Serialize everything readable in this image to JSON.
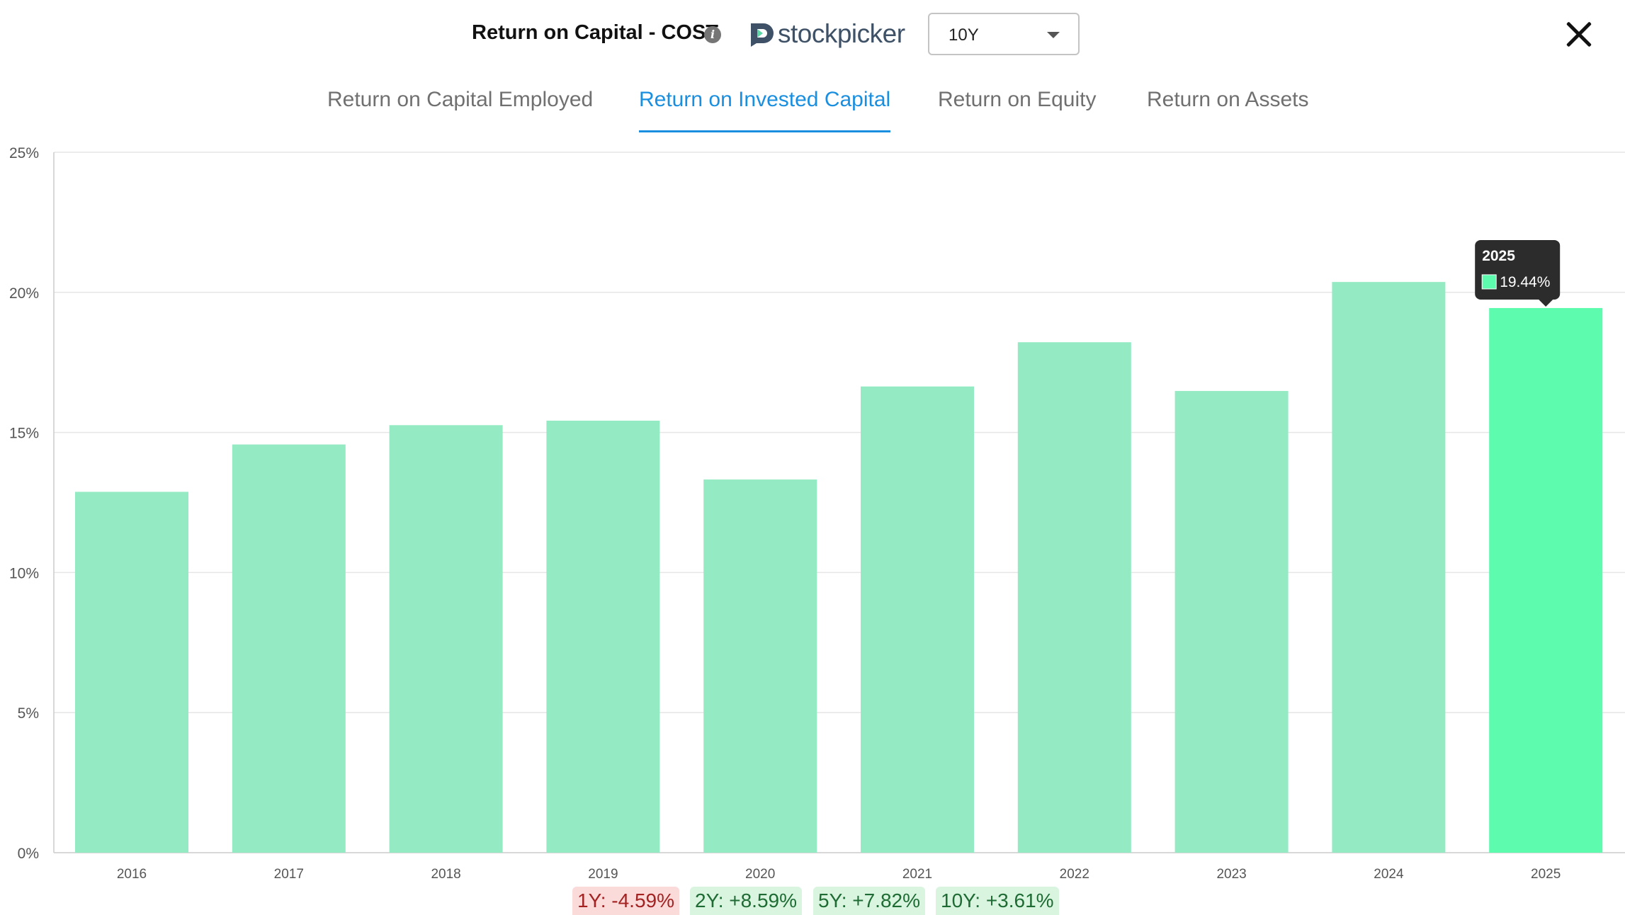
{
  "header": {
    "title": "Return on Capital - COST",
    "info_icon": "info-icon",
    "brand": "stockpicker",
    "period": "10Y",
    "close_icon": "close-icon"
  },
  "tabs": [
    {
      "label": "Return on Capital Employed",
      "active": false
    },
    {
      "label": "Return on Invested Capital",
      "active": true
    },
    {
      "label": "Return on Equity",
      "active": false
    },
    {
      "label": "Return on Assets",
      "active": false
    }
  ],
  "colors": {
    "bar": "#94ebc3",
    "bar_highlight": "#5cfbae",
    "accent": "#1a8fe0",
    "tooltip_bg": "#2c2c2c"
  },
  "chart_data": {
    "type": "bar",
    "categories": [
      "2016",
      "2017",
      "2018",
      "2019",
      "2020",
      "2021",
      "2022",
      "2023",
      "2024",
      "2025"
    ],
    "values": [
      12.88,
      14.57,
      15.26,
      15.42,
      13.32,
      16.64,
      18.22,
      16.48,
      20.37,
      19.44
    ],
    "ylim": [
      0,
      25
    ],
    "yticks": [
      "0%",
      "5%",
      "10%",
      "15%",
      "20%",
      "25%"
    ],
    "grid": true,
    "highlight_index": 9,
    "tooltip": {
      "label": "2025",
      "value": "19.44%"
    }
  },
  "changes": [
    {
      "label": "1Y: -4.59%",
      "sign": "neg"
    },
    {
      "label": "2Y: +8.59%",
      "sign": "pos"
    },
    {
      "label": "5Y: +7.82%",
      "sign": "pos"
    },
    {
      "label": "10Y: +3.61%",
      "sign": "pos"
    }
  ]
}
